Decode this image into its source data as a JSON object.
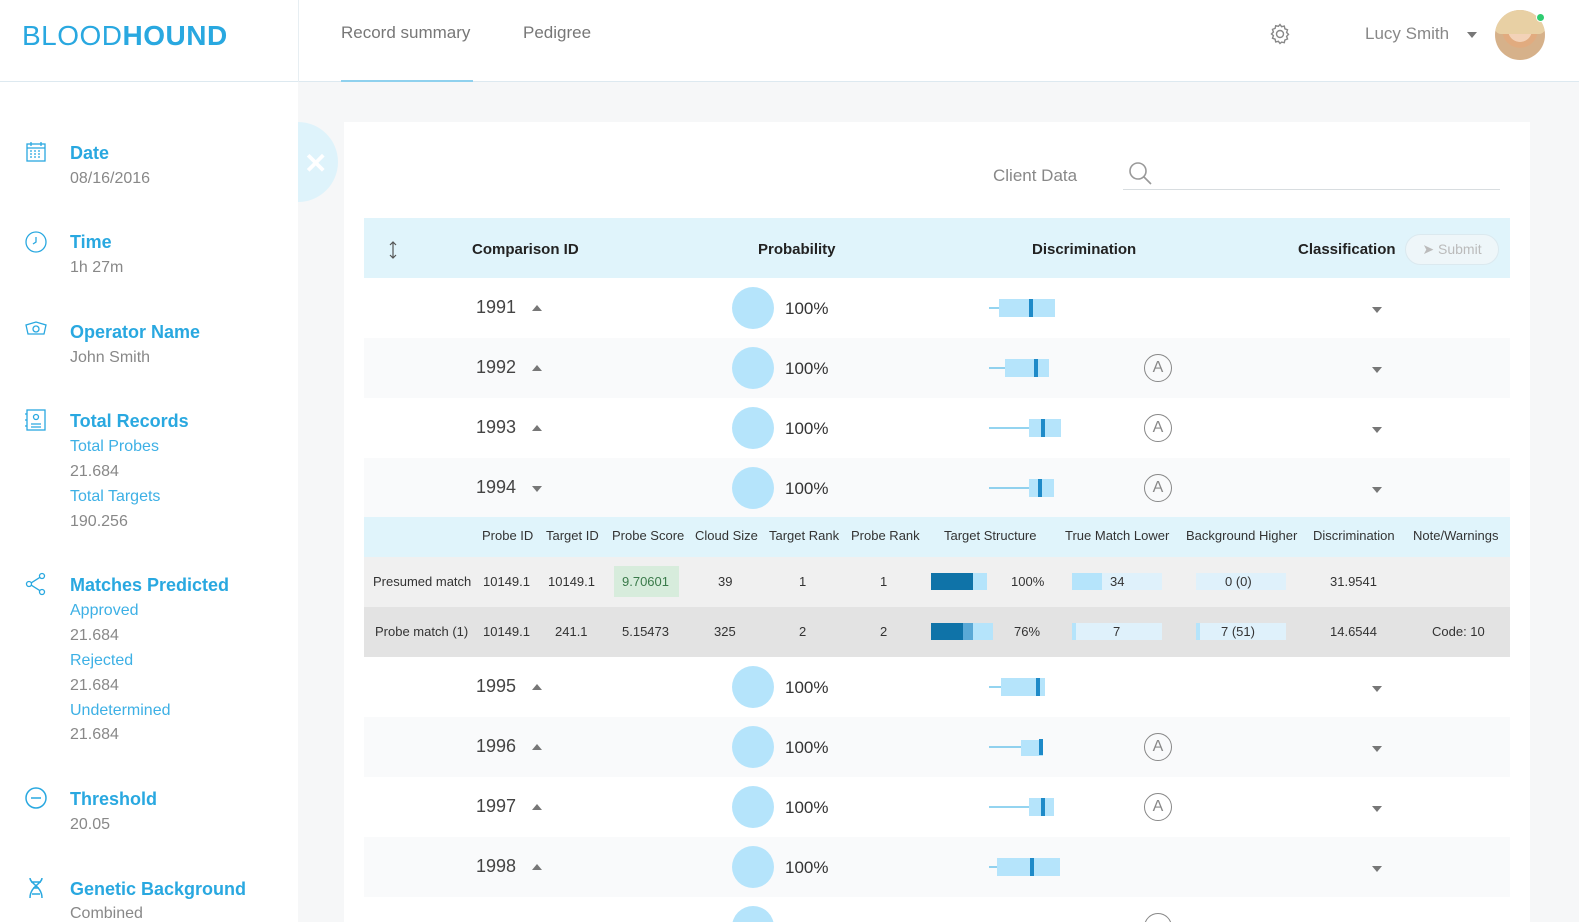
{
  "header": {
    "logo_light": "BLOOD",
    "logo_bold": "HOUND",
    "tabs": [
      {
        "label": "Record summary",
        "active": true
      },
      {
        "label": "Pedigree",
        "active": false
      }
    ],
    "user_name": "Lucy Smith",
    "icons": {
      "settings": "gear-icon",
      "user_menu": "chevron-down-icon",
      "status": "online"
    }
  },
  "sidebar": {
    "date": {
      "title": "Date",
      "value": "08/16/2016",
      "icon": "calendar-icon"
    },
    "time": {
      "title": "Time",
      "value": "1h 27m",
      "icon": "clock-icon"
    },
    "operator": {
      "title": "Operator Name",
      "value": "John Smith",
      "icon": "operator-icon"
    },
    "records": {
      "title": "Total Records",
      "probes_label": "Total Probes",
      "probes_value": "21.684",
      "targets_label": "Total Targets",
      "targets_value": "190.256",
      "icon": "records-icon"
    },
    "matches": {
      "title": "Matches Predicted",
      "approved_label": "Approved",
      "approved_value": "21.684",
      "rejected_label": "Rejected",
      "rejected_value": "21.684",
      "undetermined_label": "Undetermined",
      "undetermined_value": "21.684",
      "icon": "share-icon"
    },
    "threshold": {
      "title": "Threshold",
      "value": "20.05",
      "icon": "minus-circle-icon"
    },
    "genetic": {
      "title": "Genetic Background",
      "value": "Combined",
      "icon": "dna-icon"
    }
  },
  "panel": {
    "close_label": "✕",
    "client_label": "Client Data",
    "search_placeholder": "",
    "columns": {
      "comparison": "Comparison ID",
      "probability": "Probability",
      "discrimination": "Discrimination",
      "classification": "Classification"
    },
    "submit_label": "Submit"
  },
  "rows": [
    {
      "id": "1991",
      "prob": "100%",
      "badge": ""
    },
    {
      "id": "1992",
      "prob": "100%",
      "badge": "A"
    },
    {
      "id": "1993",
      "prob": "100%",
      "badge": "A"
    },
    {
      "id": "1994",
      "prob": "100%",
      "badge": "A"
    },
    {
      "id": "1995",
      "prob": "100%",
      "badge": ""
    },
    {
      "id": "1996",
      "prob": "100%",
      "badge": "A"
    },
    {
      "id": "1997",
      "prob": "100%",
      "badge": "A"
    },
    {
      "id": "1998",
      "prob": "100%",
      "badge": ""
    }
  ],
  "detail": {
    "headers": [
      "Probe ID",
      "Target ID",
      "Probe Score",
      "Cloud Size",
      "Target Rank",
      "Probe Rank",
      "Target Structure",
      "True Match Lower",
      "Background Higher",
      "Discrimination",
      "Note/Warnings"
    ],
    "rows": [
      {
        "type": "Presumed match",
        "probe_id": "10149.1",
        "target_id": "10149.1",
        "probe_score": "9.70601",
        "cloud_size": "39",
        "target_rank": "1",
        "probe_rank": "1",
        "structure": "100%",
        "true_lower": "34",
        "bg_higher": "0 (0)",
        "discrimination": "31.9541",
        "note": ""
      },
      {
        "type": "Probe match (1)",
        "probe_id": "10149.1",
        "target_id": "241.1",
        "probe_score": "5.15473",
        "cloud_size": "325",
        "target_rank": "2",
        "probe_rank": "2",
        "structure": "76%",
        "true_lower": "7",
        "bg_higher": "7 (51)",
        "discrimination": "14.6544",
        "note": "Code: 10"
      }
    ]
  },
  "colors": {
    "accent": "#29a8e0",
    "header_bg": "#e0f4fb",
    "bubble": "#b5e4fb",
    "bar_dark": "#0f73a8"
  }
}
